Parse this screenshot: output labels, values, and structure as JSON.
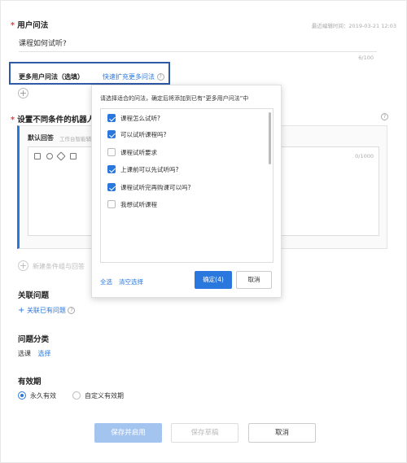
{
  "user_question": {
    "required_mark": "*",
    "label": "用户问法",
    "last_edited": "最近编辑时间：2019-03-21 12:03",
    "value": "课程如何试听?",
    "counter": "6/100"
  },
  "more_questions": {
    "label": "更多用户问法（选填）",
    "expand_link": "快速扩充更多问法",
    "help_icon": "question-circle-icon"
  },
  "robot_condition": {
    "required_mark": "*",
    "label": "设置不同条件的机器人",
    "default_reply_label": "默认回答",
    "default_reply_hint": "工作台智能辅",
    "reply_counter": "0/1000",
    "add_condition": "新建条件组与回答"
  },
  "related": {
    "label": "关联问题",
    "add_link": "关联已有问题"
  },
  "category": {
    "label": "问题分类",
    "value": "选课",
    "select_link": "选择"
  },
  "validity": {
    "label": "有效期",
    "options": [
      {
        "label": "永久有效",
        "selected": true
      },
      {
        "label": "自定义有效期",
        "selected": false
      }
    ]
  },
  "footer": {
    "save_enable": "保存并启用",
    "save_draft": "保存草稿",
    "cancel": "取消"
  },
  "popup": {
    "title": "请选择适合的问法，确定后将添加到已有“更多用户问法”中",
    "options": [
      {
        "label": "课程怎么试听?",
        "checked": true
      },
      {
        "label": "可以试听课程吗?",
        "checked": true
      },
      {
        "label": "课程试听要求",
        "checked": false
      },
      {
        "label": "上课前可以先试听吗?",
        "checked": true
      },
      {
        "label": "课程试听完再购课可以吗?",
        "checked": true
      },
      {
        "label": "我想试听课程",
        "checked": false
      }
    ],
    "select_all": "全选",
    "clear": "清空选择",
    "confirm": "确定(4)",
    "cancel": "取消"
  },
  "colors": {
    "accent": "#2a77dd",
    "highlight_border": "#2e5aa8",
    "required": "#e0403a"
  }
}
